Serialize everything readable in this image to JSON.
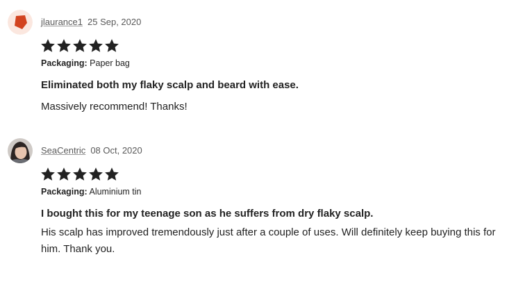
{
  "reviews": [
    {
      "username": "jlaurance1",
      "date": "25 Sep, 2020",
      "rating": 5,
      "packaging_label": "Packaging:",
      "packaging_value": "Paper bag",
      "headline": "Eliminated both my flaky scalp and beard with ease.",
      "body": "Massively recommend! Thanks!"
    },
    {
      "username": "SeaCentric",
      "date": "08 Oct, 2020",
      "rating": 5,
      "packaging_label": "Packaging:",
      "packaging_value": "Aluminium tin",
      "headline": "I bought this for my teenage son as he suffers from dry flaky scalp.",
      "body": "His scalp has improved tremendously just after a couple of uses. Will definitely keep buying this for him. Thank you."
    }
  ],
  "icons": {
    "avatar_1": "red-hexagon-avatar-icon",
    "avatar_2": "user-photo-avatar",
    "star": "star-icon"
  },
  "colors": {
    "star": "#222222",
    "avatar_1_bg": "#fbe7df",
    "avatar_1_shape": "#d2431f"
  }
}
